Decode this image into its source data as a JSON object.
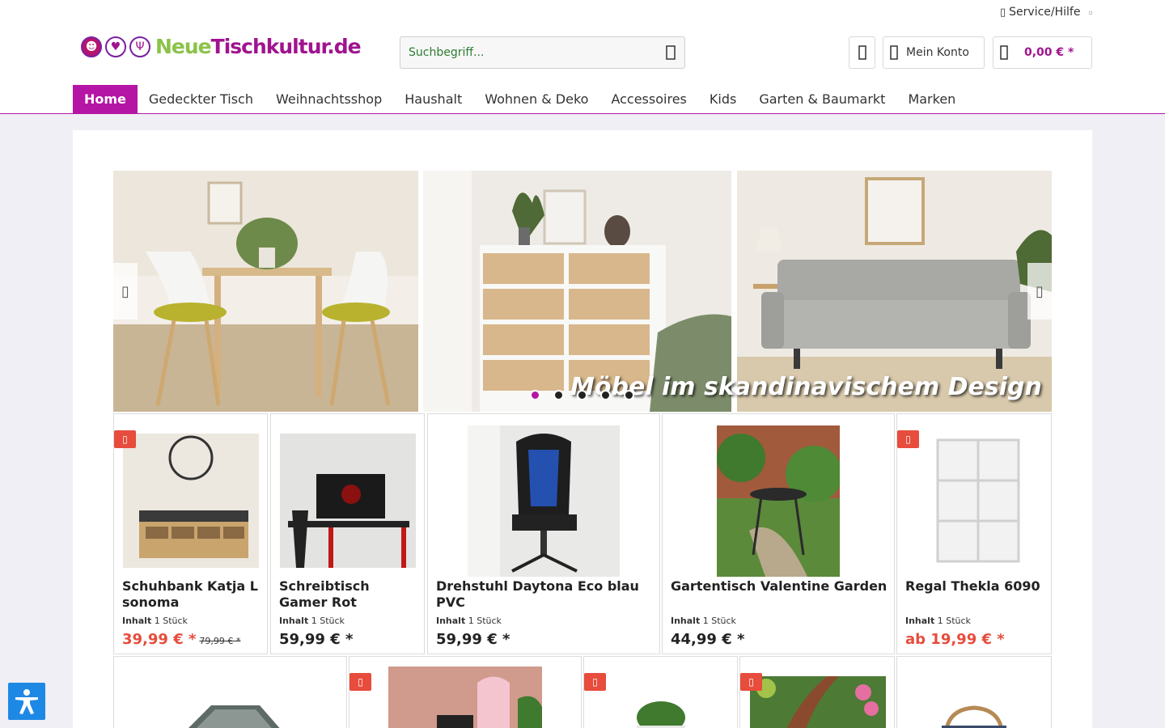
{
  "header": {
    "service_label": "Service/Hilfe",
    "logo": {
      "part1": "Neue",
      "part2": "Tischkultur.de"
    },
    "search_placeholder": "Suchbegriff...",
    "account_label": "Mein Konto",
    "cart_amount": "0,00 € *"
  },
  "nav": {
    "items": [
      "Home",
      "Gedeckter Tisch",
      "Weihnachtsshop",
      "Haushalt",
      "Wohnen & Deko",
      "Accessoires",
      "Kids",
      "Garten & Baumarkt",
      "Marken"
    ],
    "active": "Home"
  },
  "slider": {
    "caption": "Möbel im skandinavischem Design",
    "dots_count": 5,
    "active_dot": 1
  },
  "products": [
    {
      "name": "Schuhbank Katja L sonoma",
      "content_label": "Inhalt",
      "content_value": "1 Stück",
      "price": "39,99 € *",
      "old_price": "79,99 € *",
      "sale": true,
      "badge": true
    },
    {
      "name": "Schreibtisch Gamer Rot",
      "content_label": "Inhalt",
      "content_value": "1 Stück",
      "price": "59,99 € *",
      "sale": false,
      "badge": false
    },
    {
      "name": "Drehstuhl Daytona Eco blau PVC",
      "content_label": "Inhalt",
      "content_value": "1 Stück",
      "price": "59,99 € *",
      "sale": false,
      "badge": false
    },
    {
      "name": "Gartentisch Valentine Garden",
      "content_label": "Inhalt",
      "content_value": "1 Stück",
      "price": "44,99 € *",
      "sale": false,
      "badge": false
    },
    {
      "name": "Regal Thekla 6090",
      "content_label": "Inhalt",
      "content_value": "1 Stück",
      "price": "ab 19,99 € *",
      "sale": true,
      "badge": true
    }
  ],
  "colors": {
    "brand": "#b515a4",
    "sale": "#e74c3c",
    "logo_green": "#8bc34a"
  }
}
